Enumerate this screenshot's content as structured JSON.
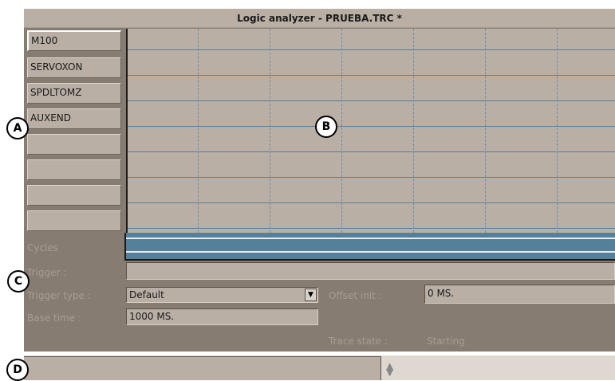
{
  "window": {
    "title": "Logic analyzer - PRUEBA.TRC *"
  },
  "signals": [
    "M100",
    "SERVOXON",
    "SPDLTOMZ",
    "AUXEND",
    "",
    "",
    "",
    ""
  ],
  "labels": {
    "cycles": "Cycles",
    "trigger": "Trigger :",
    "trigger_type": "Trigger type :",
    "base_time": "Base time :",
    "offset_init": "Offset init :",
    "trace_state": "Trace state :"
  },
  "fields": {
    "trigger_value": "",
    "trigger_type_value": "Default",
    "base_time_value": "1000 MS.",
    "offset_init_value": "0 MS.",
    "trace_state_value": "Starting"
  },
  "markers": {
    "a": "A",
    "b": "B",
    "c": "C",
    "d": "D"
  },
  "status": {
    "left_text": ""
  },
  "icons": {
    "dropdown": "chevron-down-icon",
    "sort": "sort-arrows-icon"
  }
}
